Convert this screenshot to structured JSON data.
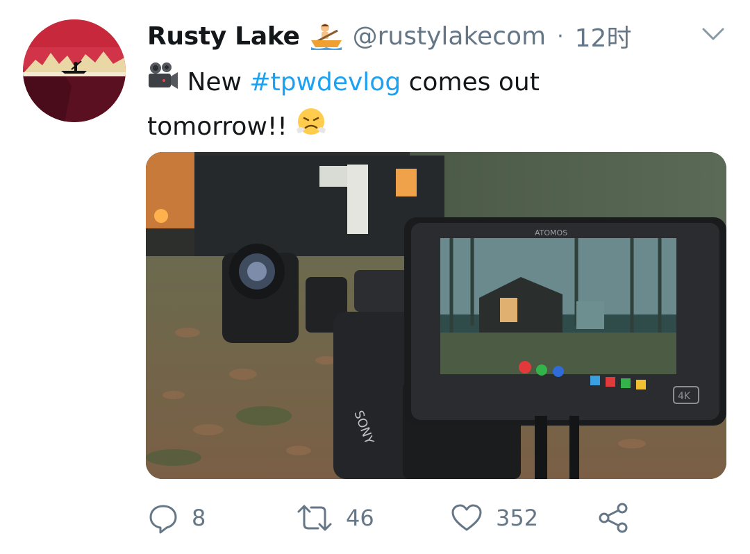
{
  "tweet": {
    "author_name": "Rusty Lake",
    "author_handle": "@rustylakecom",
    "separator": "·",
    "time": "12时",
    "text_before": "New ",
    "hashtag": "#tpwdevlog",
    "text_after": " comes out tomorrow!!",
    "badge_emoji": "person-rowing-boat",
    "leading_emoji": "movie-camera",
    "trailing_emoji": "face-with-steam-from-nose",
    "media_alt": "camera rig with ATOMOS monitor filming a wooden cabin in the forest",
    "monitor_brand": "ATOMOS",
    "camera_brand": "SONY",
    "monitor_badge": "4K"
  },
  "actions": {
    "replies": "8",
    "retweets": "46",
    "likes": "352"
  },
  "icons": {
    "reply": "reply-icon",
    "retweet": "retweet-icon",
    "like": "heart-icon",
    "share": "share-icon",
    "menu": "chevron-down-icon"
  },
  "colors": {
    "hashtag": "#1da1f2",
    "secondary_text": "#657786",
    "primary_text": "#14171a"
  }
}
